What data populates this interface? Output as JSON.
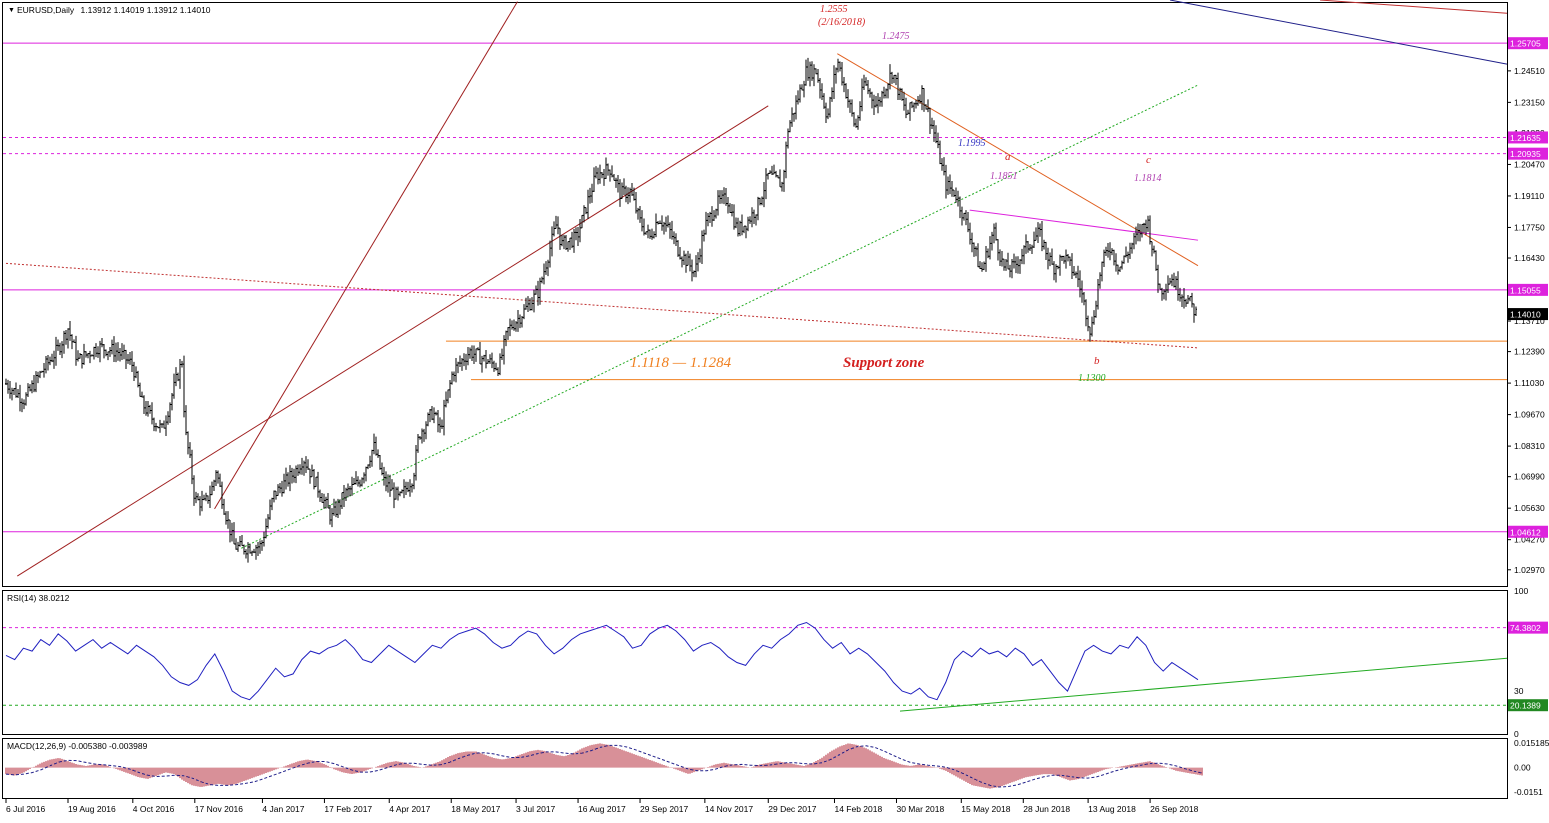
{
  "chart_data": {
    "type": "candlestick",
    "main": {
      "header": {
        "symbol": "EURUSD,Daily",
        "ohlc": "1.13912 1.14019 1.13912 1.14010"
      },
      "ylim": [
        1.0227,
        1.2744
      ],
      "y_ticks": [
        "1.02970",
        "1.04270",
        "1.05630",
        "1.06990",
        "1.08310",
        "1.09670",
        "1.11030",
        "1.12390",
        "1.13710",
        "1.15055",
        "1.16430",
        "1.17750",
        "1.19110",
        "1.20470",
        "1.21830",
        "1.23150",
        "1.24510"
      ],
      "current_price": "1.14010",
      "horizontal_levels": [
        {
          "label": "1.25705",
          "value": 1.25705,
          "color": "#dd22dd",
          "style": "solid"
        },
        {
          "label": "1.21635",
          "value": 1.21635,
          "color": "#dd22dd",
          "style": "dashed"
        },
        {
          "label": "1.20935",
          "value": 1.20935,
          "color": "#dd22dd",
          "style": "dashed"
        },
        {
          "label": "1.15055",
          "value": 1.15055,
          "color": "#dd22dd",
          "style": "solid"
        },
        {
          "label": "1.04612",
          "value": 1.04612,
          "color": "#dd22dd",
          "style": "solid"
        }
      ],
      "support_zone": {
        "low": 1.1118,
        "high": 1.1284,
        "range_label": "1.1118 — 1.1284",
        "label": "Support zone"
      },
      "annotations": [
        {
          "text": "1.2555",
          "color": "#d42020"
        },
        {
          "text": "(2/16/2018)",
          "color": "#d42020"
        },
        {
          "text": "1.2475",
          "color": "#b040b0"
        },
        {
          "text": "1.1995",
          "color": "#3030c0"
        },
        {
          "text": "a",
          "color": "#d42020"
        },
        {
          "text": "1.1851",
          "color": "#b040b0"
        },
        {
          "text": "c",
          "color": "#d42020"
        },
        {
          "text": "1.1814",
          "color": "#b040b0"
        },
        {
          "text": "b",
          "color": "#d42020"
        },
        {
          "text": "1.1300",
          "color": "#22aa22"
        }
      ],
      "price_path": [
        [
          "6 Jul 2016",
          1.11
        ],
        [
          "19 Jul 2016",
          1.103
        ],
        [
          "1 Aug 2016",
          1.116
        ],
        [
          "12 Aug 2016",
          1.125
        ],
        [
          "19 Aug 2016",
          1.134
        ],
        [
          "26 Aug 2016",
          1.12
        ],
        [
          "9 Sep 2016",
          1.126
        ],
        [
          "23 Sep 2016",
          1.124
        ],
        [
          "4 Oct 2016",
          1.118
        ],
        [
          "10 Oct 2016",
          1.102
        ],
        [
          "19 Oct 2016",
          1.094
        ],
        [
          "25 Oct 2016",
          1.09
        ],
        [
          "3 Nov 2016",
          1.11
        ],
        [
          "8 Nov 2016",
          1.12
        ],
        [
          "10 Nov 2016",
          1.09
        ],
        [
          "14 Nov 2016",
          1.075
        ],
        [
          "17 Nov 2016",
          1.06
        ],
        [
          "24 Nov 2016",
          1.058
        ],
        [
          "30 Nov 2016",
          1.066
        ],
        [
          "2 Dec 2016",
          1.073
        ],
        [
          "8 Dec 2016",
          1.056
        ],
        [
          "15 Dec 2016",
          1.04
        ],
        [
          "20 Dec 2016",
          1.039
        ],
        [
          "3 Jan 2017",
          1.04
        ],
        [
          "12 Jan 2017",
          1.062
        ],
        [
          "27 Jan 2017",
          1.072
        ],
        [
          "2 Feb 2017",
          1.078
        ],
        [
          "14 Feb 2017",
          1.063
        ],
        [
          "22 Feb 2017",
          1.052
        ],
        [
          "3 Mar 2017",
          1.062
        ],
        [
          "14 Mar 2017",
          1.068
        ],
        [
          "24 Mar 2017",
          1.083
        ],
        [
          "31 Mar 2017",
          1.068
        ],
        [
          "11 Apr 2017",
          1.06
        ],
        [
          "21 Apr 2017",
          1.07
        ],
        [
          "25 Apr 2017",
          1.088
        ],
        [
          "5 May 2017",
          1.098
        ],
        [
          "10 May 2017",
          1.09
        ],
        [
          "19 May 2017",
          1.115
        ],
        [
          "31 May 2017",
          1.124
        ],
        [
          "9 Jun 2017",
          1.121
        ],
        [
          "21 Jun 2017",
          1.117
        ],
        [
          "27 Jun 2017",
          1.133
        ],
        [
          "7 Jul 2017",
          1.14
        ],
        [
          "19 Jul 2017",
          1.15
        ],
        [
          "1 Aug 2017",
          1.18
        ],
        [
          "4 Aug 2017",
          1.17
        ],
        [
          "15 Aug 2017",
          1.173
        ],
        [
          "25 Aug 2017",
          1.193
        ],
        [
          "29 Aug 2017",
          1.2
        ],
        [
          "8 Sep 2017",
          1.203
        ],
        [
          "15 Sep 2017",
          1.192
        ],
        [
          "22 Sep 2017",
          1.193
        ],
        [
          "29 Sep 2017",
          1.18
        ],
        [
          "6 Oct 2017",
          1.173
        ],
        [
          "12 Oct 2017",
          1.182
        ],
        [
          "20 Oct 2017",
          1.176
        ],
        [
          "26 Oct 2017",
          1.168
        ],
        [
          "7 Nov 2017",
          1.158
        ],
        [
          "14 Nov 2017",
          1.178
        ],
        [
          "23 Nov 2017",
          1.188
        ],
        [
          "30 Nov 2017",
          1.19
        ],
        [
          "7 Dec 2017",
          1.176
        ],
        [
          "14 Dec 2017",
          1.18
        ],
        [
          "21 Dec 2017",
          1.186
        ],
        [
          "29 Dec 2017",
          1.2
        ],
        [
          "8 Jan 2018",
          1.196
        ],
        [
          "12 Jan 2018",
          1.22
        ],
        [
          "25 Jan 2018",
          1.245
        ],
        [
          "1 Feb 2018",
          1.245
        ],
        [
          "9 Feb 2018",
          1.225
        ],
        [
          "16 Feb 2018",
          1.25
        ],
        [
          "1 Mar 2018",
          1.22
        ],
        [
          "7 Mar 2018",
          1.24
        ],
        [
          "16 Mar 2018",
          1.23
        ],
        [
          "27 Mar 2018",
          1.245
        ],
        [
          "6 Apr 2018",
          1.226
        ],
        [
          "17 Apr 2018",
          1.236
        ],
        [
          "25 Apr 2018",
          1.22
        ],
        [
          "4 May 2018",
          1.196
        ],
        [
          "11 May 2018",
          1.192
        ],
        [
          "21 May 2018",
          1.175
        ],
        [
          "29 May 2018",
          1.158
        ],
        [
          "7 Jun 2018",
          1.176
        ],
        [
          "14 Jun 2018",
          1.16
        ],
        [
          "21 Jun 2018",
          1.16
        ],
        [
          "29 Jun 2018",
          1.168
        ],
        [
          "9 Jul 2018",
          1.175
        ],
        [
          "19 Jul 2018",
          1.16
        ],
        [
          "27 Jul 2018",
          1.165
        ],
        [
          "6 Aug 2018",
          1.155
        ],
        [
          "15 Aug 2018",
          1.132
        ],
        [
          "22 Aug 2018",
          1.16
        ],
        [
          "28 Aug 2018",
          1.17
        ],
        [
          "4 Sep 2018",
          1.16
        ],
        [
          "13 Sep 2018",
          1.17
        ],
        [
          "24 Sep 2018",
          1.181
        ],
        [
          "3 Oct 2018",
          1.15
        ],
        [
          "11 Oct 2018",
          1.156
        ],
        [
          "17 Oct 2018",
          1.15
        ],
        [
          "23 Oct 2018",
          1.146
        ],
        [
          "29 Oct 2018",
          1.14
        ]
      ]
    },
    "rsi": {
      "label": "RSI(14) 38.0212",
      "ylim": [
        0,
        100
      ],
      "y_ticks": [
        "100",
        "30",
        "0"
      ],
      "levels": [
        {
          "label": "74.3802",
          "value": 74.3802
        },
        {
          "label": "20.1389",
          "value": 20.1389
        }
      ],
      "values": [
        55,
        52,
        60,
        58,
        66,
        62,
        70,
        65,
        58,
        62,
        66,
        60,
        64,
        60,
        56,
        62,
        58,
        54,
        48,
        40,
        36,
        34,
        38,
        48,
        56,
        44,
        30,
        26,
        24,
        30,
        38,
        46,
        40,
        42,
        52,
        58,
        56,
        60,
        62,
        66,
        60,
        52,
        50,
        56,
        62,
        58,
        54,
        50,
        56,
        62,
        60,
        66,
        70,
        72,
        74,
        70,
        64,
        60,
        62,
        68,
        72,
        70,
        62,
        56,
        60,
        66,
        70,
        72,
        74,
        76,
        72,
        68,
        60,
        62,
        70,
        74,
        76,
        72,
        66,
        58,
        62,
        64,
        60,
        54,
        50,
        48,
        56,
        62,
        60,
        66,
        70,
        76,
        78,
        74,
        66,
        60,
        64,
        56,
        60,
        56,
        50,
        44,
        36,
        30,
        28,
        32,
        26,
        24,
        36,
        52,
        58,
        54,
        60,
        56,
        58,
        54,
        60,
        56,
        48,
        52,
        44,
        36,
        30,
        44,
        58,
        62,
        58,
        56,
        62,
        60,
        68,
        62,
        50,
        44,
        50,
        46,
        42,
        38
      ]
    },
    "macd": {
      "label": "MACD(12,26,9) -0.005380 -0.003989",
      "ylim": [
        -0.0188,
        0.0177
      ],
      "y_ticks": [
        "0.015185",
        "0.00",
        "-0.0151"
      ],
      "values": [
        -0.004,
        -0.005,
        -0.003,
        0.0,
        0.003,
        0.005,
        0.006,
        0.004,
        0.002,
        0.001,
        0.002,
        0.002,
        0.0,
        -0.002,
        -0.004,
        -0.006,
        -0.007,
        -0.005,
        -0.003,
        -0.004,
        -0.008,
        -0.011,
        -0.012,
        -0.011,
        -0.01,
        -0.011,
        -0.01,
        -0.008,
        -0.006,
        -0.004,
        -0.002,
        0.0,
        0.002,
        0.004,
        0.005,
        0.004,
        0.002,
        -0.001,
        -0.003,
        -0.004,
        -0.003,
        -0.001,
        0.001,
        0.003,
        0.004,
        0.003,
        0.001,
        0.0,
        0.002,
        0.004,
        0.007,
        0.009,
        0.01,
        0.01,
        0.008,
        0.006,
        0.005,
        0.006,
        0.008,
        0.01,
        0.011,
        0.01,
        0.008,
        0.007,
        0.009,
        0.012,
        0.014,
        0.015,
        0.014,
        0.012,
        0.01,
        0.008,
        0.006,
        0.004,
        0.002,
        0.0,
        -0.002,
        -0.004,
        -0.002,
        0.0,
        0.002,
        0.003,
        0.002,
        0.001,
        0.0,
        0.002,
        0.003,
        0.004,
        0.003,
        0.002,
        0.001,
        0.003,
        0.006,
        0.01,
        0.013,
        0.015,
        0.014,
        0.012,
        0.009,
        0.006,
        0.004,
        0.002,
        0.001,
        0.002,
        0.001,
        0.0,
        -0.002,
        -0.005,
        -0.008,
        -0.011,
        -0.012,
        -0.013,
        -0.012,
        -0.01,
        -0.008,
        -0.006,
        -0.005,
        -0.004,
        -0.004,
        -0.006,
        -0.008,
        -0.007,
        -0.005,
        -0.003,
        -0.001,
        0.0,
        0.001,
        0.002,
        0.003,
        0.004,
        0.002,
        0.0,
        -0.002,
        -0.003,
        -0.004,
        -0.005
      ]
    },
    "x_ticks": [
      "6 Jul 2016",
      "19 Aug 2016",
      "4 Oct 2016",
      "17 Nov 2016",
      "4 Jan 2017",
      "17 Feb 2017",
      "4 Apr 2017",
      "18 May 2017",
      "3 Jul 2017",
      "16 Aug 2017",
      "29 Sep 2017",
      "14 Nov 2017",
      "29 Dec 2017",
      "14 Feb 2018",
      "30 Mar 2018",
      "15 May 2018",
      "28 Jun 2018",
      "13 Aug 2018",
      "26 Sep 2018"
    ],
    "colors": {
      "level": "#dd22dd",
      "channel": "#a02020",
      "trend_dotted": "#22aa22",
      "rsi_line": "#2020c0",
      "macd_hist": "#b02030",
      "zone": "#f08020",
      "text_zone": "#f08020",
      "support_label": "#d42020"
    }
  }
}
